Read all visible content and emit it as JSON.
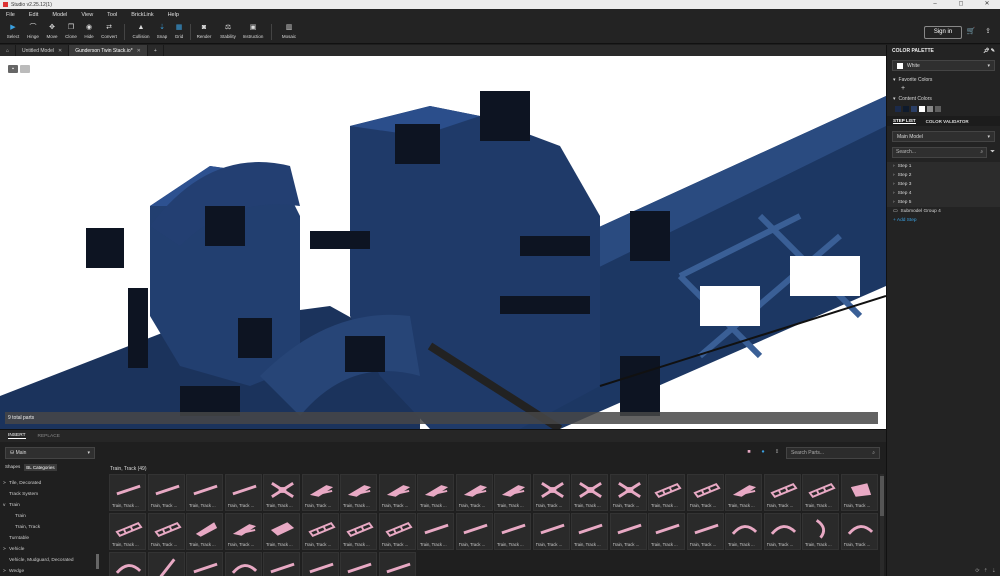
{
  "window": {
    "title": "Studio v2.25.12(1)",
    "min": "–",
    "max": "◻",
    "close": "✕"
  },
  "menu": [
    "File",
    "Edit",
    "Model",
    "View",
    "Tool",
    "BrickLink",
    "Help"
  ],
  "toolbar": {
    "tools": [
      {
        "label": "Select",
        "icon": "▶"
      },
      {
        "label": "Hinge",
        "icon": "⌒"
      },
      {
        "label": "Move",
        "icon": "✥"
      },
      {
        "label": "Clone",
        "icon": "❐"
      },
      {
        "label": "Hide",
        "icon": "◉"
      },
      {
        "label": "Convert",
        "icon": "⇄"
      },
      {
        "label": "Collision",
        "icon": "▲"
      },
      {
        "label": "Snap",
        "icon": "⇣"
      },
      {
        "label": "Grid",
        "icon": "▦"
      },
      {
        "label": "Render",
        "icon": "◙"
      },
      {
        "label": "Stability",
        "icon": "⚖"
      },
      {
        "label": "Instruction",
        "icon": "▣"
      },
      {
        "label": "Mosaic",
        "icon": "▥"
      }
    ],
    "sign_in": "Sign in",
    "cart_icon": "🛒",
    "upload_icon": "⇪"
  },
  "tabs": [
    {
      "label": "Untitled Model",
      "active": false
    },
    {
      "label": "Gunderson Twin Stack.io*",
      "active": true
    }
  ],
  "viewport": {
    "total_parts": "9 total parts"
  },
  "right_panel": {
    "color_palette_title": "COLOR PALETTE",
    "selected_color": "White",
    "favorite_colors": "Favorite Colors",
    "favorite_add": "+",
    "content_colors": "Content Colors",
    "content_swatches": [
      "#1b2a4a",
      "#0e1a2c",
      "#2b3f66",
      "#ffffff",
      "#8a8a8a",
      "#5f5f5f"
    ],
    "subtabs": [
      "STEP LIST",
      "COLOR VALIDATOR"
    ],
    "model": "Main Model",
    "search_placeholder": "Search...",
    "steps": [
      "Step 1",
      "Step 2",
      "Step 3",
      "Step 4",
      "Step 5"
    ],
    "submodel": "Submodel Group 4",
    "add_step": "+ Add Step"
  },
  "bottom": {
    "tabs": [
      "INSERT",
      "REPLACE"
    ],
    "palette": "Main",
    "shapes_label": "Shapes",
    "categories_label": "BL Categories",
    "categories": [
      {
        "label": "Tile, Decorated",
        "sub": false,
        "arrow": ">"
      },
      {
        "label": "Track System",
        "sub": false,
        "arrow": ""
      },
      {
        "label": "Train",
        "sub": false,
        "arrow": "v"
      },
      {
        "label": "Train",
        "sub": true,
        "arrow": ""
      },
      {
        "label": "Train, Track",
        "sub": true,
        "arrow": ""
      },
      {
        "label": "Turntable",
        "sub": false,
        "arrow": ""
      },
      {
        "label": "Vehicle",
        "sub": false,
        "arrow": ">"
      },
      {
        "label": "Vehicle, Mudguard, Decorated",
        "sub": false,
        "arrow": ""
      },
      {
        "label": "Wedge",
        "sub": false,
        "arrow": ">"
      }
    ],
    "search_placeholder": "Search Parts...",
    "grid_title": "Train, Track (49)",
    "part_label": "Train, Track ...",
    "part_color": "#e8a9c4"
  }
}
